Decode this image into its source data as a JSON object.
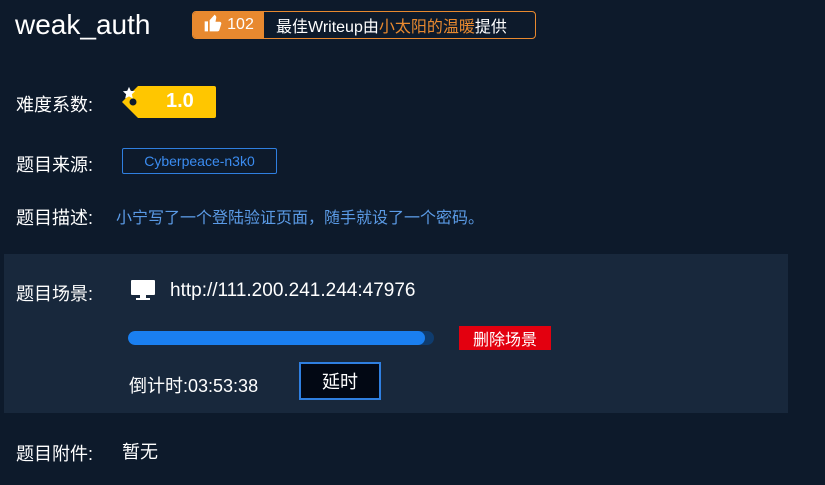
{
  "challenge": {
    "title": "weak_auth"
  },
  "likes": {
    "count": "102",
    "text_prefix": "最佳Writeup由",
    "author": "小太阳的温暖",
    "text_suffix": "提供",
    "accent_color": "#e8892f",
    "icon": "thumbs-up-icon"
  },
  "difficulty": {
    "label": "难度系数:",
    "value": "1.0",
    "color": "#ffc600",
    "icon": "star-icon"
  },
  "source": {
    "label": "题目来源:",
    "value": "Cyberpeace-n3k0"
  },
  "description": {
    "label": "题目描述:",
    "text": "小宁写了一个登陆验证页面，随手就设了一个密码。"
  },
  "scene": {
    "label": "题目场景:",
    "icon": "monitor-icon",
    "url": "http://111.200.241.244:47976",
    "progress_percent": 97,
    "delete_label": "删除场景",
    "countdown_label": "倒计时:",
    "countdown_value": "03:53:38",
    "delay_label": "延时"
  },
  "attachment": {
    "label": "题目附件:",
    "value": "暂无"
  }
}
